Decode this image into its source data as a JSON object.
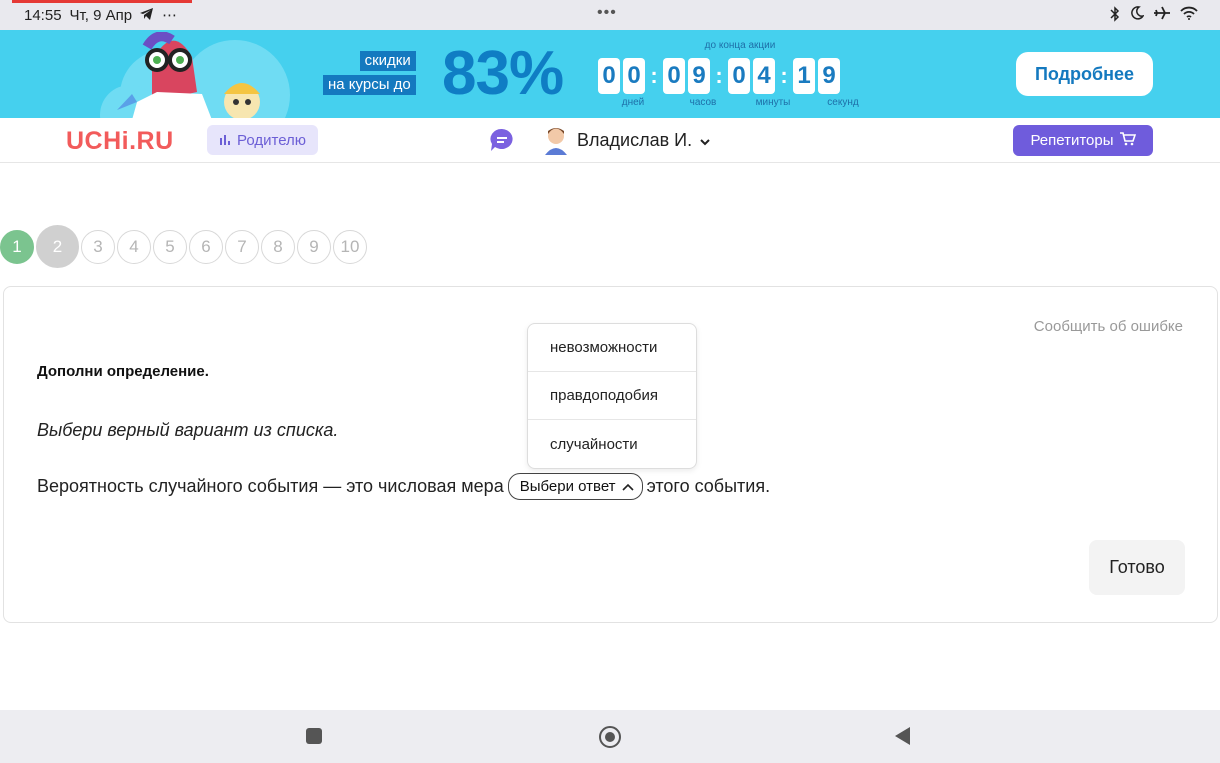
{
  "statusbar": {
    "time": "14:55",
    "date": "Чт, 9 Апр",
    "extra": "⋯",
    "center_dots": "•••"
  },
  "banner": {
    "label_line1": "скидки",
    "label_line2": "на курсы до",
    "percent": "83%",
    "caption": "до конца акции",
    "digits": [
      "0",
      "0",
      "0",
      "9",
      "0",
      "4",
      "1",
      "9"
    ],
    "units": [
      "дней",
      "часов",
      "минуты",
      "секунд"
    ],
    "more_label": "Подробнее",
    "colors": {
      "background": "#45d0ee",
      "accent": "#1479bf"
    }
  },
  "header": {
    "logo": "UCHi.RU",
    "parent_label": "Родителю",
    "user_name": "Владислав И.",
    "tutors_label": "Репетиторы",
    "colors": {
      "logo": "#f25b5b",
      "tutors": "#6f5cdc"
    }
  },
  "steps": {
    "items": [
      "1",
      "2",
      "3",
      "4",
      "5",
      "6",
      "7",
      "8",
      "9",
      "10"
    ],
    "completed": 1,
    "current": 2
  },
  "task": {
    "report_label": "Сообщить об ошибке",
    "title": "Дополни определение.",
    "hint": "Выбери верный вариант из списка.",
    "sentence_before": "Вероятность случайного события — это числовая мера",
    "sentence_after": "этого события.",
    "select_placeholder": "Выбери ответ",
    "options": [
      "невозможности",
      "правдоподобия",
      "случайности"
    ],
    "done_label": "Готово"
  }
}
